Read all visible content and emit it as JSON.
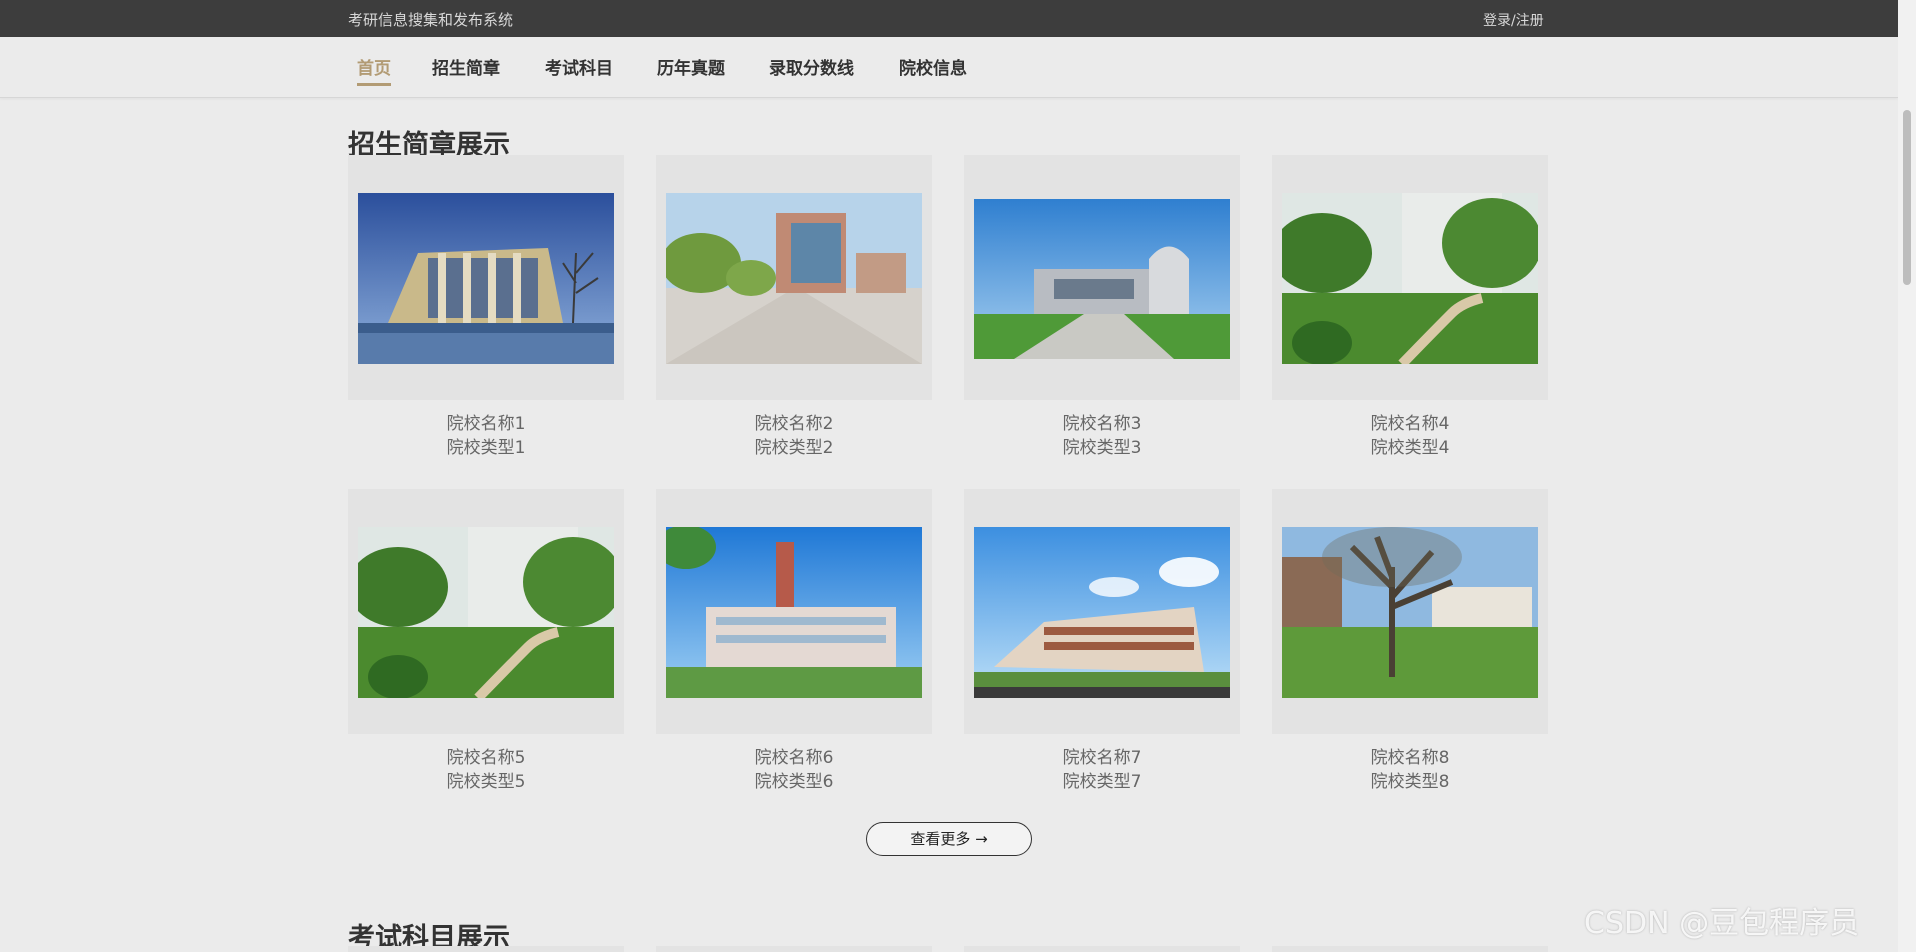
{
  "header": {
    "site_title": "考研信息搜集和发布系统",
    "login_label": "登录/注册"
  },
  "nav": {
    "items": [
      "首页",
      "招生简章",
      "考试科目",
      "历年真题",
      "录取分数线",
      "院校信息"
    ],
    "active_index": 0
  },
  "sections": {
    "brochure_title": "招生简章展示",
    "subjects_title": "考试科目展示"
  },
  "cards": [
    {
      "name": "院校名称1",
      "type": "院校类型1"
    },
    {
      "name": "院校名称2",
      "type": "院校类型2"
    },
    {
      "name": "院校名称3",
      "type": "院校类型3"
    },
    {
      "name": "院校名称4",
      "type": "院校类型4"
    },
    {
      "name": "院校名称5",
      "type": "院校类型5"
    },
    {
      "name": "院校名称6",
      "type": "院校类型6"
    },
    {
      "name": "院校名称7",
      "type": "院校类型7"
    },
    {
      "name": "院校名称8",
      "type": "院校类型8"
    }
  ],
  "more_button": {
    "label": "查看更多 →"
  },
  "watermark": "CSDN @豆包程序员"
}
